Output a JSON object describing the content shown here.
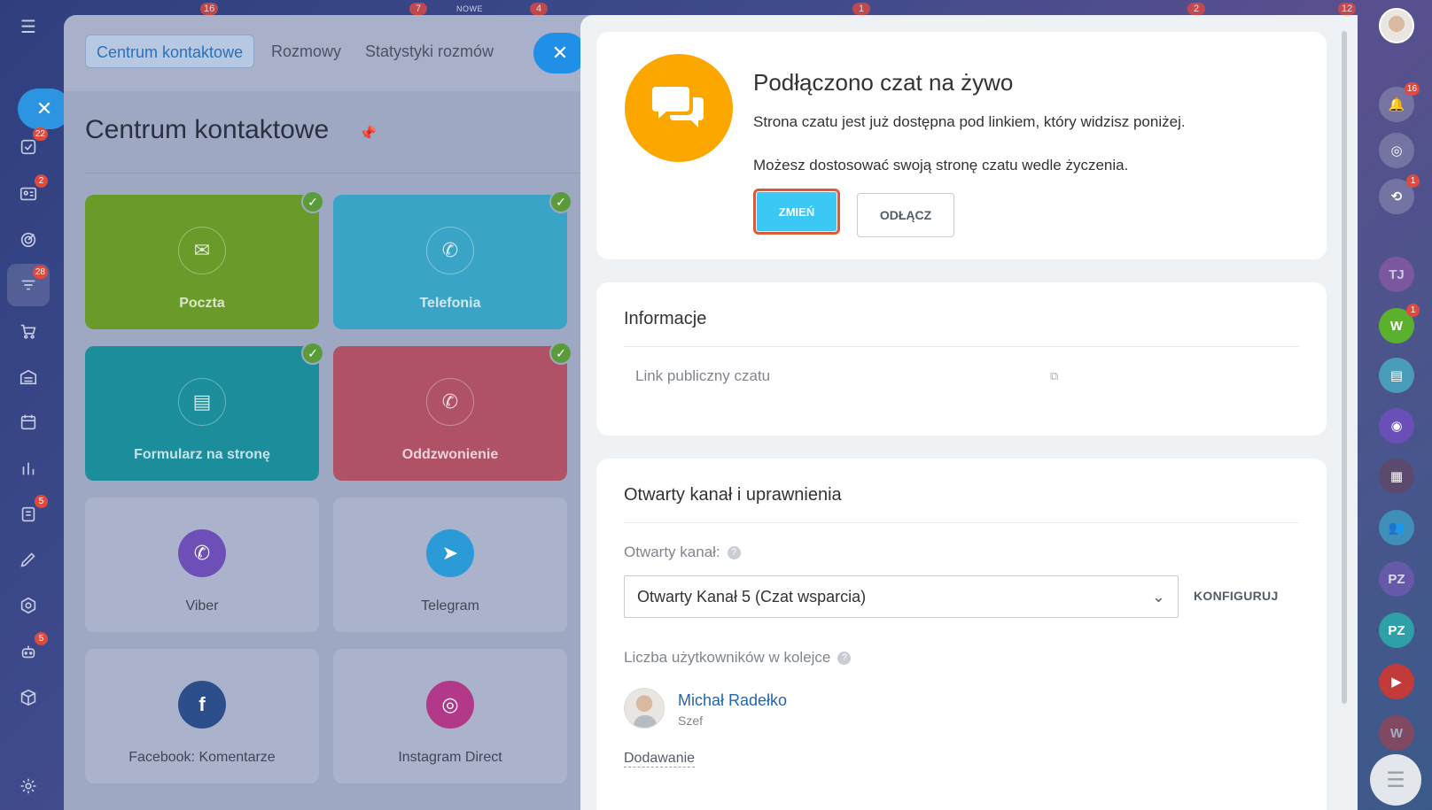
{
  "top_strip": {
    "badges": [
      "16",
      "7",
      "4",
      "1",
      "2",
      "12"
    ],
    "nowe_label": "NOWE"
  },
  "left_rail": {
    "badges": {
      "tasks": "22",
      "contacts": "2",
      "contact_center": "28",
      "docs": "5",
      "robots": "5"
    }
  },
  "tabs": [
    {
      "label": "Centrum kontaktowe",
      "active": true
    },
    {
      "label": "Rozmowy",
      "active": false
    },
    {
      "label": "Statystyki rozmów",
      "active": false
    }
  ],
  "main": {
    "title": "Centrum kontaktowe",
    "tiles": [
      {
        "label": "Poczta",
        "icon": "mail-icon",
        "color": "#6a9a2a",
        "checked": true
      },
      {
        "label": "Telefonia",
        "icon": "phone-icon",
        "color": "#3aa4c6",
        "checked": true
      },
      {
        "label": "Formularz na stronę",
        "icon": "form-icon",
        "color": "#1b8d9b",
        "checked": true
      },
      {
        "label": "Oddzwonienie",
        "icon": "callback-icon",
        "color": "#b05266",
        "checked": true
      },
      {
        "label": "Viber",
        "icon": "viber-icon",
        "color": "#6e4fb8",
        "checked": false
      },
      {
        "label": "Telegram",
        "icon": "telegram-icon",
        "color": "#2a9bd6",
        "checked": false
      },
      {
        "label": "Facebook: Komentarze",
        "icon": "facebook-icon",
        "color": "#2c4f8c",
        "checked": false
      },
      {
        "label": "Instagram Direct",
        "icon": "instagram-icon",
        "color": "#b2388a",
        "checked": false
      }
    ]
  },
  "connected": {
    "title": "Podłączono czat na żywo",
    "text1": "Strona czatu jest już dostępna pod linkiem, który widzisz poniżej.",
    "text2": "Możesz dostosować swoją stronę czatu wedle życzenia.",
    "change_label": "ZMIEŃ",
    "disconnect_label": "ODŁĄCZ"
  },
  "info": {
    "title": "Informacje",
    "link_label": "Link publiczny czatu"
  },
  "channel": {
    "title": "Otwarty kanał i uprawnienia",
    "open_channel_label": "Otwarty kanał:",
    "selected_channel": "Otwarty Kanał 5 (Czat wsparcia)",
    "configure_label": "KONFIGURUJ",
    "queue_label": "Liczba użytkowników w kolejce",
    "user_name": "Michał Radełko",
    "user_role": "Szef",
    "add_label": "Dodawanie"
  },
  "right_rail": {
    "notifications_badge": "16",
    "chat_badge": "1",
    "w_badge": "1",
    "items": [
      "TJ",
      "W",
      "PZ",
      "PZ",
      "W"
    ]
  },
  "colors": {
    "accent_blue": "#3bc8f5",
    "chat_orange": "#fba700",
    "highlight_red": "#e05a3a",
    "link_blue": "#2067b0"
  }
}
